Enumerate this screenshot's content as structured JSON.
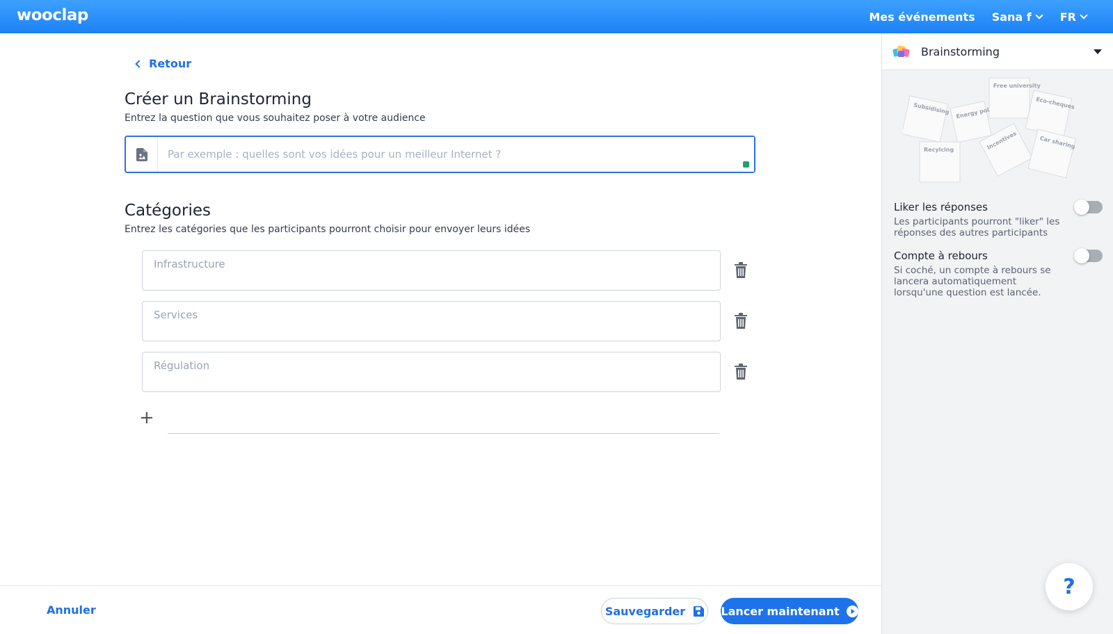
{
  "header": {
    "logo": "wooclap",
    "nav": {
      "events": "Mes événements",
      "user": "Sana f",
      "lang": "FR"
    }
  },
  "main": {
    "back_label": "Retour",
    "title": "Créer un Brainstorming",
    "subtitle": "Entrez la question que vous souhaitez poser à votre audience",
    "question_placeholder": "Par exemple : quelles sont vos idées pour un meilleur Internet ?",
    "categories_title": "Catégories",
    "categories_subtitle": "Entrez les catégories que les participants pourront choisir pour envoyer leurs idées",
    "categories": [
      {
        "placeholder": "Infrastructure"
      },
      {
        "placeholder": "Services"
      },
      {
        "placeholder": "Régulation"
      }
    ],
    "add_category_icon": "plus-icon"
  },
  "footer": {
    "cancel": "Annuler",
    "save": "Sauvegarder",
    "launch": "Lancer maintenant"
  },
  "sidebar": {
    "type_label": "Brainstorming",
    "illustration_notes": [
      "Subsidising",
      "Energy policy",
      "Free university",
      "Eco-cheques",
      "Recylcing",
      "Incentives",
      "Car sharing"
    ],
    "options": [
      {
        "title": "Liker les réponses",
        "desc": "Les participants pourront \"liker\" les réponses des autres participants",
        "enabled": false
      },
      {
        "title": "Compte à rebours",
        "desc": "Si coché, un compte à rebours se lancera automatiquement lorsqu'une question est lancée.",
        "enabled": false
      }
    ]
  },
  "help_label": "?",
  "colors": {
    "brand": "#1f73ea",
    "header": "#2b8ff7",
    "accent_dot": "#1ba36a"
  }
}
